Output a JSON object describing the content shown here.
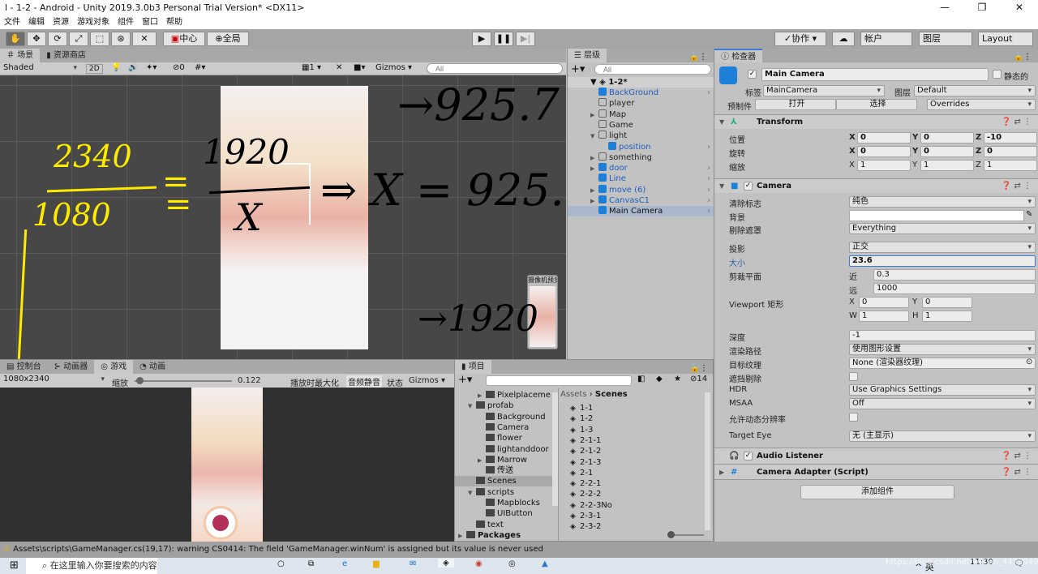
{
  "window": {
    "title": "l - 1-2 - Android - Unity 2019.3.0b3 Personal Trial Version* <DX11>",
    "minimize": "—",
    "maximize": "❐",
    "close": "✕"
  },
  "menu": [
    "文件",
    "编辑",
    "资源",
    "游戏对象",
    "组件",
    "窗口",
    "帮助"
  ],
  "toolbar": {
    "pivot": "中心",
    "global": "全局",
    "collab": "协作",
    "account": "帐户",
    "layers": "图层",
    "layout": "Layout"
  },
  "scene": {
    "tabs": [
      "场景",
      "资源商店"
    ],
    "shading": "Shaded",
    "mode2d": "2D",
    "hidden_count": "0",
    "grid_count": "1",
    "gizmos": "Gizmos",
    "search_placeholder": "All",
    "camera_preview_label": "摄像机预览"
  },
  "annotations": {
    "yellow_top": "2340",
    "yellow_bottom": "1080",
    "eq1": "=",
    "eq2": "=",
    "black_top": "1920",
    "black_bottom": "X",
    "arrow_result": "⇒ X = 925.",
    "top_result": "→925.7",
    "bottom_result": "→1920"
  },
  "hierarchy": {
    "tab": "层级",
    "search_placeholder": "All",
    "scene": "1-2*",
    "items": [
      {
        "label": "BackGround",
        "prefab": true
      },
      {
        "label": "player",
        "prefab": false
      },
      {
        "label": "Map",
        "prefab": false,
        "arrow": true
      },
      {
        "label": "Game",
        "prefab": false
      },
      {
        "label": "light",
        "prefab": false,
        "arrow": true,
        "open": true
      },
      {
        "label": "position",
        "prefab": true,
        "child": true
      },
      {
        "label": "something",
        "prefab": false,
        "arrow": true
      },
      {
        "label": "door",
        "prefab": true,
        "arrow": true
      },
      {
        "label": "Line",
        "prefab": true
      },
      {
        "label": "move (6)",
        "prefab": true,
        "arrow": true
      },
      {
        "label": "CanvasC1",
        "prefab": true,
        "arrow": true
      },
      {
        "label": "Main Camera",
        "prefab": true,
        "selected": true
      }
    ]
  },
  "inspector": {
    "tab": "检查器",
    "name": "Main Camera",
    "static": "静态的",
    "tag_label": "标签",
    "tag": "MainCamera",
    "layer_label": "图层",
    "layer": "Default",
    "prefab_label": "预制件",
    "open": "打开",
    "select": "选择",
    "overrides": "Overrides",
    "transform": {
      "title": "Transform",
      "position_label": "位置",
      "rotation_label": "旋转",
      "scale_label": "缩放",
      "position": [
        "0",
        "0",
        "-10"
      ],
      "rotation": [
        "0",
        "0",
        "0"
      ],
      "scale": [
        "1",
        "1",
        "1"
      ]
    },
    "camera": {
      "title": "Camera",
      "clear_flags_label": "清除标志",
      "clear_flags": "纯色",
      "background_label": "背景",
      "background_color": "#ffffff",
      "culling_mask_label": "剔除遮罩",
      "culling_mask": "Everything",
      "projection_label": "投影",
      "projection": "正交",
      "size_label": "大小",
      "size": "23.6",
      "clipping_label": "剪裁平面",
      "near_label": "近",
      "near": "0.3",
      "far_label": "远",
      "far": "1000",
      "viewport_label": "Viewport 矩形",
      "vx": "0",
      "vy": "0",
      "vw": "1",
      "vh": "1",
      "depth_label": "深度",
      "depth": "-1",
      "render_path_label": "渲染路径",
      "render_path": "使用图形设置",
      "target_texture_label": "目标纹理",
      "target_texture": "None (渲染器纹理)",
      "occlusion_label": "遮挡剔除",
      "hdr_label": "HDR",
      "hdr": "Use Graphics Settings",
      "msaa_label": "MSAA",
      "msaa": "Off",
      "dynamic_res_label": "允许动态分辨率",
      "target_eye_label": "Target Eye",
      "target_eye": "无 (主显示)"
    },
    "audio_listener": "Audio Listener",
    "camera_adapter": "Camera Adapter (Script)",
    "add_component": "添加组件"
  },
  "game": {
    "tabs": [
      "控制台",
      "动画器",
      "游戏",
      "动画"
    ],
    "resolution": "1080x2340",
    "scale_label": "缩放",
    "scale_value": "0.122",
    "scale_fraction": 0.02,
    "maximize": "播放时最大化",
    "mute": "音频静音",
    "stats": "状态",
    "gizmos": "Gizmos"
  },
  "project": {
    "tab": "项目",
    "hidden_count": "14",
    "tree": [
      {
        "label": "Pixelplaceme",
        "depth": 2,
        "arrow": "▶"
      },
      {
        "label": "profab",
        "depth": 1,
        "arrow": "▼"
      },
      {
        "label": "Background",
        "depth": 2
      },
      {
        "label": "Camera",
        "depth": 2
      },
      {
        "label": "flower",
        "depth": 2
      },
      {
        "label": "lightanddoor",
        "depth": 2
      },
      {
        "label": "Marrow",
        "depth": 2,
        "arrow": "▶"
      },
      {
        "label": "传送",
        "depth": 2
      },
      {
        "label": "Scenes",
        "depth": 1,
        "selected": true
      },
      {
        "label": "scripts",
        "depth": 1,
        "arrow": "▼"
      },
      {
        "label": "Mapblocks",
        "depth": 2
      },
      {
        "label": "UIButton",
        "depth": 2
      },
      {
        "label": "text",
        "depth": 1
      },
      {
        "label": "Packages",
        "depth": 0,
        "arrow": "▶",
        "bold": true
      }
    ],
    "breadcrumb": [
      "Assets",
      "Scenes"
    ],
    "scenes": [
      "1-1",
      "1-2",
      "1-3",
      "2-1-1",
      "2-1-2",
      "2-1-3",
      "2-1",
      "2-2-1",
      "2-2-2",
      "2-2-3No",
      "2-3-1",
      "2-3-2"
    ]
  },
  "status": {
    "message": "Assets\\scripts\\GameManager.cs(19,17): warning CS0414: The field 'GameManager.winNum' is assigned but its value is never used"
  },
  "taskbar": {
    "search_placeholder": "在这里输入你要搜索的内容",
    "time": "11:30",
    "ime": "英",
    "watermark": "https://blog.csdn.net/weixin_44739495"
  }
}
